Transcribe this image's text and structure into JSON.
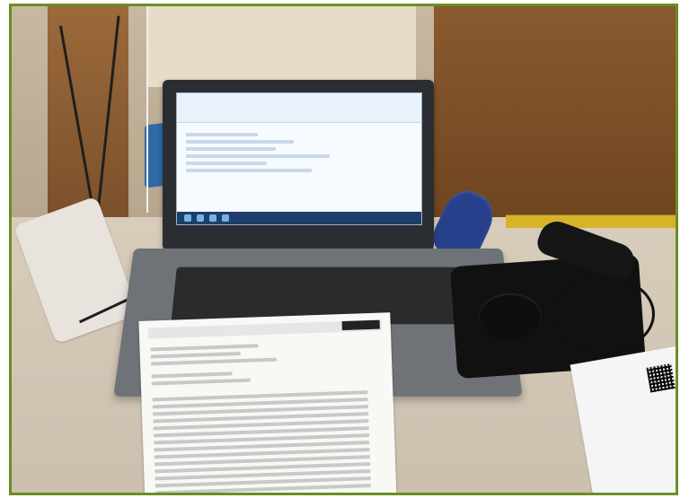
{
  "colors": {
    "frame": "#6b8e23",
    "laptop": "#2a2d31",
    "screen": "#f7fbff",
    "taskbar": "#1c3f6b",
    "receipt": "#f8f8f4",
    "mousepad": "#111111",
    "glove": "#27408b",
    "ruler": "#d7b32a"
  },
  "objects": [
    "laptop",
    "laptop-screen",
    "keyboard",
    "receipt-paper",
    "computer-mouse",
    "mousepad",
    "barcode-scanner",
    "power-strip",
    "cables",
    "blue-glove",
    "ruler"
  ]
}
